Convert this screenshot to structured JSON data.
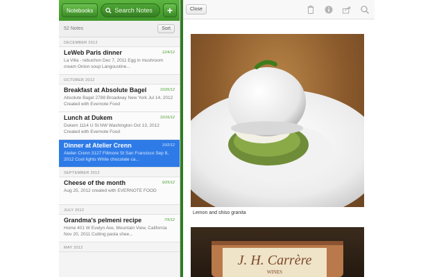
{
  "toolbar": {
    "notebooks_label": "Notebooks",
    "search_label": "Search Notes",
    "add_label": "+"
  },
  "list": {
    "count": "52 Notes",
    "sort_label": "Sort",
    "sections": [
      {
        "header": "DECEMBER 2012",
        "notes": [
          {
            "title": "LeWeb Paris dinner",
            "date": "12/4/12",
            "snippet": "La Villa - rebuchon Dec 7, 2011 Egg in mushroom cream Onion soup Langoustine..."
          }
        ]
      },
      {
        "header": "OCTOBER 2012",
        "notes": [
          {
            "title": "Breakfast at Absolute Bagel",
            "date": "10/26/12",
            "snippet": "Absolute Bagel 2788 Broadway New York Jul 14, 2012 Created with Evernote Food"
          },
          {
            "title": "Lunch at Dukem",
            "date": "10/16/12",
            "snippet": "Dukem 1114 U St NW Washington Oct 13, 2012 Created with Evernote Food"
          },
          {
            "title": "Dinner at Atelier Crenn",
            "date": "10/2/12",
            "snippet": "Atelier Crenn 3127 Fillmore St San Francisco Sep 8, 2012 Cool lights White chocolate ca..."
          }
        ]
      },
      {
        "header": "SEPTEMBER 2012",
        "notes": [
          {
            "title": "Cheese of the month",
            "date": "9/25/12",
            "snippet": "Aug 25, 2012 created with EVERNOTE FOOD"
          }
        ]
      },
      {
        "header": "JULY 2012",
        "notes": [
          {
            "title": "Grandma's pelmeni recipe",
            "date": "7/5/12",
            "snippet": "Home 401 W Evelyn Ave, Mountain View, California Nov 20, 2011 Cutting pasta shee..."
          }
        ]
      },
      {
        "header": "MAY 2012",
        "notes": []
      }
    ]
  },
  "detail": {
    "close_label": "Close",
    "caption": "Lemon and shiso granita",
    "icons": [
      "trash-icon",
      "info-icon",
      "share-icon",
      "search-icon"
    ],
    "bottle_text": "J. H. Carrère",
    "bottle_subtext": "WINES"
  },
  "colors": {
    "brand_green": "#3f9529",
    "selection_blue": "#2e7be8",
    "date_green": "#4a9e2f"
  }
}
